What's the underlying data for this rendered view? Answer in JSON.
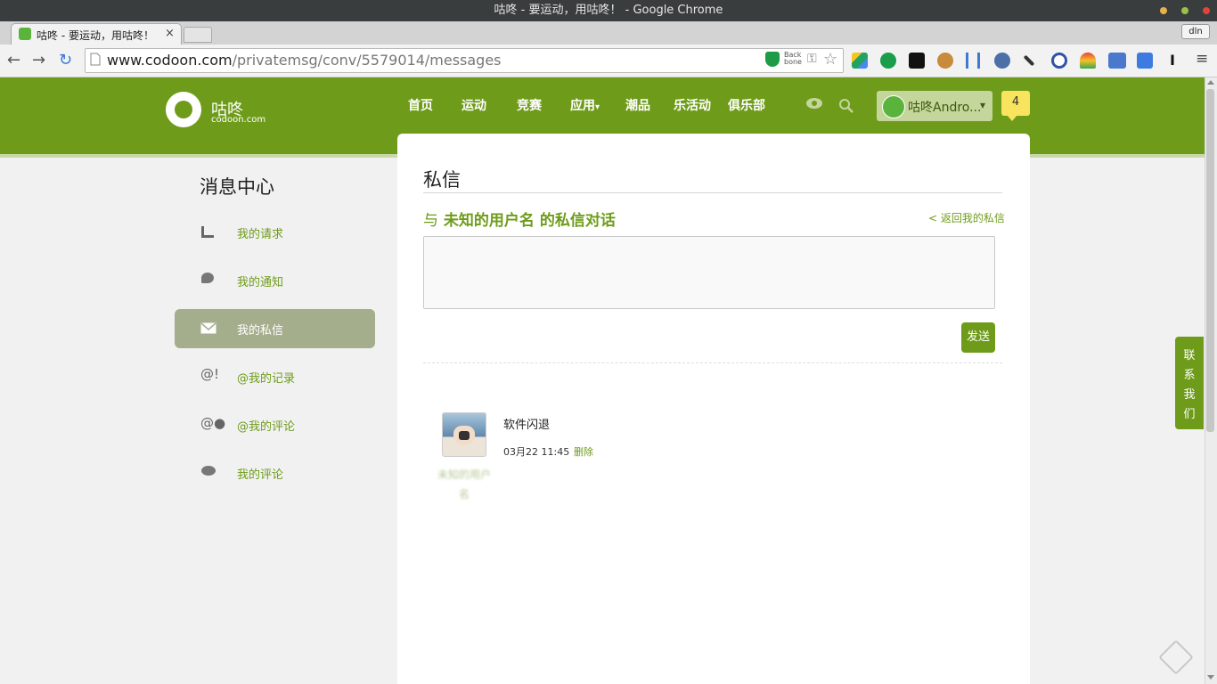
{
  "window": {
    "title": "咕咚 - 要运动，用咕咚！ - Google Chrome",
    "profile_label": "dln"
  },
  "browser": {
    "tab_title": "咕咚 - 要运动，用咕咚！",
    "tab_close": "×",
    "url_host": "www.codoon.com",
    "url_path": "/privatemsg/conv/5579014/messages",
    "backbone_label": "Back bone"
  },
  "site": {
    "logo_name": "咕咚",
    "logo_sub": "codoon.com",
    "nav": [
      "首页",
      "运动",
      "竞赛",
      "应用",
      "潮品",
      "乐活动",
      "俱乐部"
    ],
    "nav_app_caret": "▾",
    "user_name": "咕咚Andro...",
    "user_caret": "▾",
    "notification_count": "4"
  },
  "sidebar": {
    "title": "消息中心",
    "items": [
      {
        "label": "我的请求",
        "icon": "request-icon"
      },
      {
        "label": "我的通知",
        "icon": "notification-icon"
      },
      {
        "label": "我的私信",
        "icon": "mail-icon",
        "active": true
      },
      {
        "label": "@我的记录",
        "icon": "at-record-icon"
      },
      {
        "label": "@我的评论",
        "icon": "at-comment-icon"
      },
      {
        "label": "我的评论",
        "icon": "comment-icon"
      }
    ]
  },
  "main": {
    "title": "私信",
    "conv_prefix": "与",
    "conv_user": "未知的用户名",
    "conv_suffix": "的私信对话",
    "back_link": "< 返回我的私信",
    "input_value": "",
    "send_label": "发送",
    "messages": [
      {
        "sender": "未知的用户名",
        "text": "软件闪退",
        "time": "03月22 11:45",
        "delete_label": "删除"
      }
    ]
  },
  "contact": {
    "label_chars": [
      "联",
      "系",
      "我",
      "们"
    ]
  },
  "colors": {
    "brand_green": "#6e9c1a",
    "active_side": "#a5ae8c",
    "notif_yellow": "#f8e45e"
  }
}
